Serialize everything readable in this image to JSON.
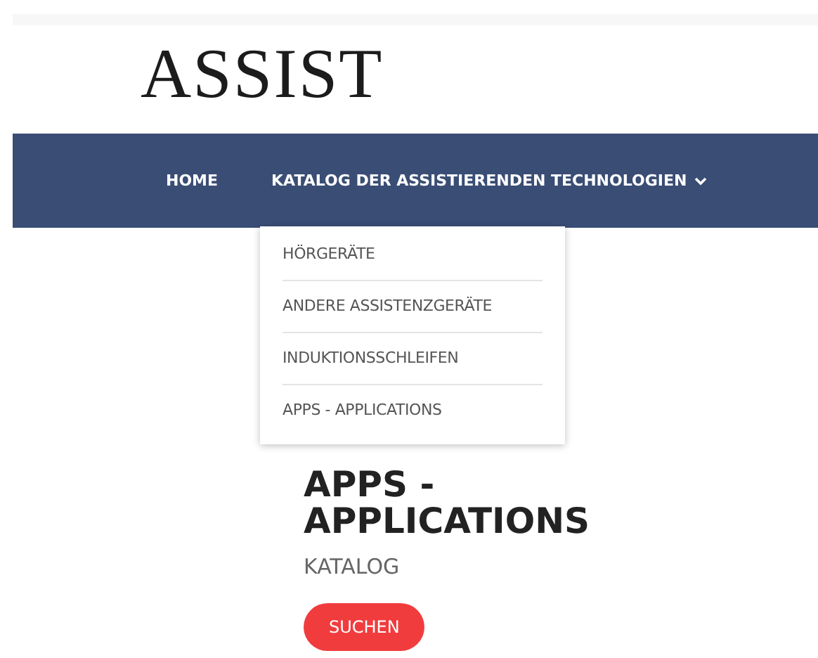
{
  "logo": {
    "text": "ASSIST"
  },
  "nav": {
    "items": [
      {
        "label": "HOME",
        "has_menu": false
      },
      {
        "label": "KATALOG DER ASSISTIERENDEN TECHNOLOGIEN",
        "has_menu": true
      }
    ]
  },
  "dropdown": {
    "items": [
      "HÖRGERÄTE",
      "ANDERE ASSISTENZGERÄTE",
      "INDUKTIONSSCHLEIFEN",
      "APPS - APPLICATIONS"
    ]
  },
  "page": {
    "title": "APPS - APPLICATIONS",
    "subtitle": "KATALOG",
    "button": "SUCHEN"
  }
}
